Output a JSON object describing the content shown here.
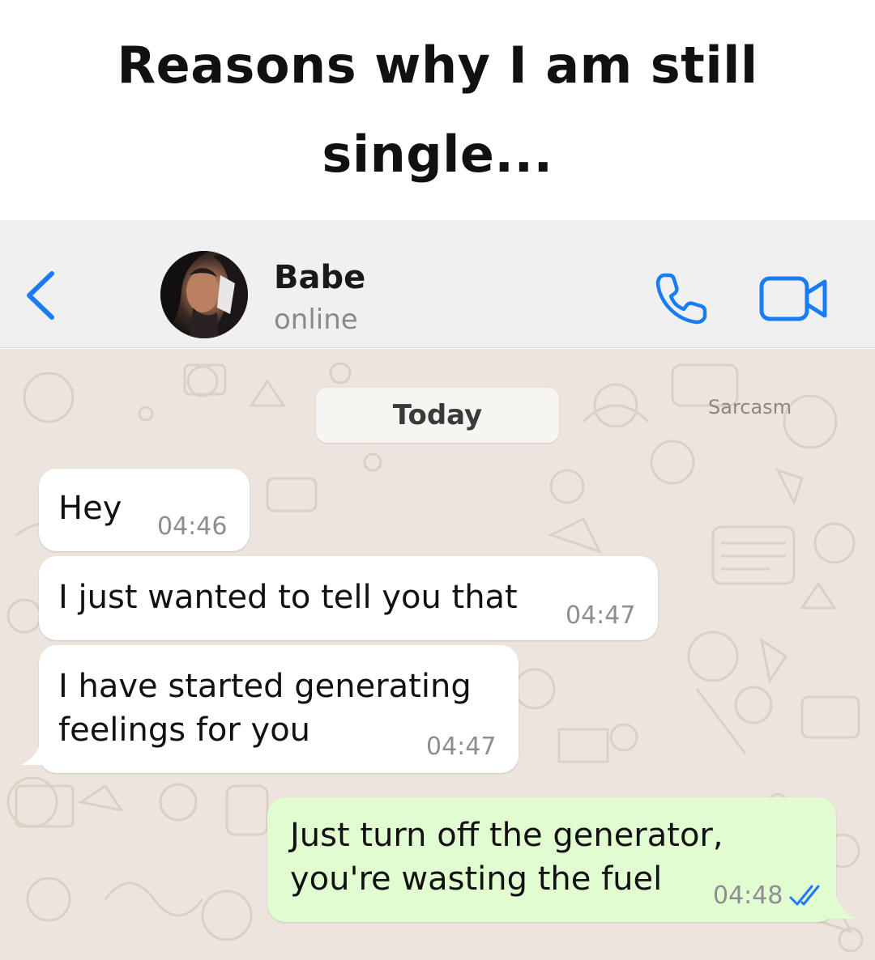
{
  "caption": "Reasons why I am still single...",
  "header": {
    "contact_name": "Babe",
    "status": "online"
  },
  "icons": {
    "back": "chevron-left-icon",
    "call": "phone-icon",
    "video": "video-camera-icon",
    "read_receipt": "double-check-icon"
  },
  "chat": {
    "date_label": "Today",
    "watermark": "Sarcasm",
    "messages": [
      {
        "direction": "incoming",
        "text": "Hey",
        "time": "04:46"
      },
      {
        "direction": "incoming",
        "text": "I just wanted to tell you that",
        "time": "04:47"
      },
      {
        "direction": "incoming",
        "text": "I have started generating\nfeelings for you",
        "time": "04:47"
      },
      {
        "direction": "outgoing",
        "text": "Just turn off the generator,\nyou're wasting the fuel",
        "time": "04:48",
        "read": true
      }
    ]
  },
  "colors": {
    "accent_blue": "#1a7cf5",
    "incoming_bubble": "#ffffff",
    "outgoing_bubble": "#e2fcd2",
    "chat_background": "#ece5dd",
    "header_background": "#f1f0f1"
  }
}
